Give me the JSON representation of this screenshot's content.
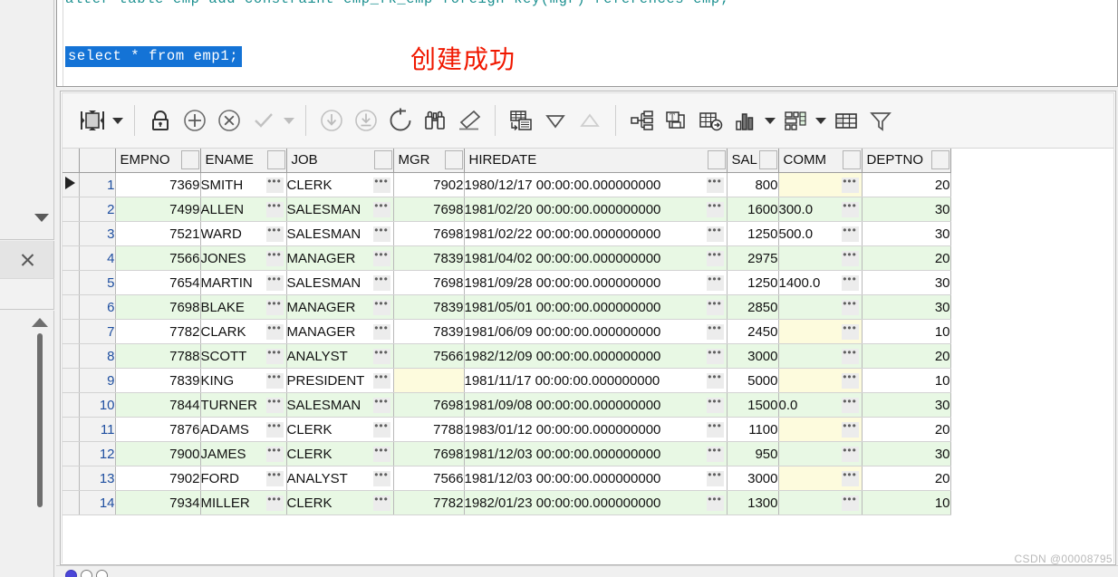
{
  "editor": {
    "line1_prefix": "alter table ",
    "line1_full": "alter table emp add constraint emp_fk_emp foreign key(mgr) references emp;",
    "line2_selected": "select * from emp1;",
    "annotation": "创建成功"
  },
  "toolbar": {
    "items": [
      {
        "name": "single-record-view-icon",
        "label": "Single Record View",
        "dim": false,
        "caret": true
      },
      {
        "name": "lock-icon",
        "label": "Lock Record",
        "dim": false,
        "caret": false
      },
      {
        "name": "plus-circle-icon",
        "label": "Insert Record",
        "dim": false,
        "caret": false
      },
      {
        "name": "cancel-circle-icon",
        "label": "Delete Record",
        "dim": false,
        "caret": false
      },
      {
        "name": "check-icon",
        "label": "Post Edit",
        "dim": true,
        "caret": true
      },
      {
        "name": "download-circle-icon",
        "label": "Fetch Next",
        "dim": true,
        "caret": false
      },
      {
        "name": "download-all-circle-icon",
        "label": "Fetch All",
        "dim": true,
        "caret": false
      },
      {
        "name": "refresh-circle-icon",
        "label": "Refresh",
        "dim": false,
        "caret": false
      },
      {
        "name": "binoculars-icon",
        "label": "Find",
        "dim": false,
        "caret": false
      },
      {
        "name": "eraser-icon",
        "label": "Clear Filter",
        "dim": false,
        "caret": false
      },
      {
        "name": "grid-to-text-icon",
        "label": "Copy as Text",
        "dim": false,
        "caret": false
      },
      {
        "name": "sort-descending-icon",
        "label": "Sort Descending",
        "dim": false,
        "caret": false
      },
      {
        "name": "sort-ascending-icon",
        "label": "Sort Ascending",
        "dim": true,
        "caret": false
      },
      {
        "name": "tree-view-icon",
        "label": "Tree View",
        "dim": false,
        "caret": false
      },
      {
        "name": "export-text-icon",
        "label": "Export Text",
        "dim": false,
        "caret": false
      },
      {
        "name": "grid-export-icon",
        "label": "Export Grid",
        "dim": false,
        "caret": false
      },
      {
        "name": "bar-chart-icon",
        "label": "Chart",
        "dim": false,
        "caret": true
      },
      {
        "name": "pivot-grid-icon",
        "label": "Pivot",
        "dim": false,
        "caret": true
      },
      {
        "name": "table-grid-icon",
        "label": "Grid View",
        "dim": false,
        "caret": false
      },
      {
        "name": "funnel-filter-icon",
        "label": "Filter",
        "dim": false,
        "caret": false
      }
    ]
  },
  "grid": {
    "columns": [
      "EMPNO",
      "ENAME",
      "JOB",
      "MGR",
      "HIREDATE",
      "SAL",
      "COMM",
      "DEPTNO"
    ],
    "selected_row": 1,
    "rows": [
      {
        "n": "1",
        "EMPNO": "7369",
        "ENAME": "SMITH",
        "JOB": "CLERK",
        "MGR": "7902",
        "HIREDATE": "1980/12/17 00:00:00.000000000",
        "SAL": "800",
        "COMM": "",
        "DEPTNO": "20"
      },
      {
        "n": "2",
        "EMPNO": "7499",
        "ENAME": "ALLEN",
        "JOB": "SALESMAN",
        "MGR": "7698",
        "HIREDATE": "1981/02/20 00:00:00.000000000",
        "SAL": "1600",
        "COMM": "300.0",
        "DEPTNO": "30"
      },
      {
        "n": "3",
        "EMPNO": "7521",
        "ENAME": "WARD",
        "JOB": "SALESMAN",
        "MGR": "7698",
        "HIREDATE": "1981/02/22 00:00:00.000000000",
        "SAL": "1250",
        "COMM": "500.0",
        "DEPTNO": "30"
      },
      {
        "n": "4",
        "EMPNO": "7566",
        "ENAME": "JONES",
        "JOB": "MANAGER",
        "MGR": "7839",
        "HIREDATE": "1981/04/02 00:00:00.000000000",
        "SAL": "2975",
        "COMM": "",
        "DEPTNO": "20"
      },
      {
        "n": "5",
        "EMPNO": "7654",
        "ENAME": "MARTIN",
        "JOB": "SALESMAN",
        "MGR": "7698",
        "HIREDATE": "1981/09/28 00:00:00.000000000",
        "SAL": "1250",
        "COMM": "1400.0",
        "DEPTNO": "30"
      },
      {
        "n": "6",
        "EMPNO": "7698",
        "ENAME": "BLAKE",
        "JOB": "MANAGER",
        "MGR": "7839",
        "HIREDATE": "1981/05/01 00:00:00.000000000",
        "SAL": "2850",
        "COMM": "",
        "DEPTNO": "30"
      },
      {
        "n": "7",
        "EMPNO": "7782",
        "ENAME": "CLARK",
        "JOB": "MANAGER",
        "MGR": "7839",
        "HIREDATE": "1981/06/09 00:00:00.000000000",
        "SAL": "2450",
        "COMM": "",
        "DEPTNO": "10"
      },
      {
        "n": "8",
        "EMPNO": "7788",
        "ENAME": "SCOTT",
        "JOB": "ANALYST",
        "MGR": "7566",
        "HIREDATE": "1982/12/09 00:00:00.000000000",
        "SAL": "3000",
        "COMM": "",
        "DEPTNO": "20"
      },
      {
        "n": "9",
        "EMPNO": "7839",
        "ENAME": "KING",
        "JOB": "PRESIDENT",
        "MGR": "",
        "HIREDATE": "1981/11/17 00:00:00.000000000",
        "SAL": "5000",
        "COMM": "",
        "DEPTNO": "10"
      },
      {
        "n": "10",
        "EMPNO": "7844",
        "ENAME": "TURNER",
        "JOB": "SALESMAN",
        "MGR": "7698",
        "HIREDATE": "1981/09/08 00:00:00.000000000",
        "SAL": "1500",
        "COMM": "0.0",
        "DEPTNO": "30"
      },
      {
        "n": "11",
        "EMPNO": "7876",
        "ENAME": "ADAMS",
        "JOB": "CLERK",
        "MGR": "7788",
        "HIREDATE": "1983/01/12 00:00:00.000000000",
        "SAL": "1100",
        "COMM": "",
        "DEPTNO": "20"
      },
      {
        "n": "12",
        "EMPNO": "7900",
        "ENAME": "JAMES",
        "JOB": "CLERK",
        "MGR": "7698",
        "HIREDATE": "1981/12/03 00:00:00.000000000",
        "SAL": "950",
        "COMM": "",
        "DEPTNO": "30"
      },
      {
        "n": "13",
        "EMPNO": "7902",
        "ENAME": "FORD",
        "JOB": "ANALYST",
        "MGR": "7566",
        "HIREDATE": "1981/12/03 00:00:00.000000000",
        "SAL": "3000",
        "COMM": "",
        "DEPTNO": "20"
      },
      {
        "n": "14",
        "EMPNO": "7934",
        "ENAME": "MILLER",
        "JOB": "CLERK",
        "MGR": "7782",
        "HIREDATE": "1982/01/23 00:00:00.000000000",
        "SAL": "1300",
        "COMM": "",
        "DEPTNO": "10"
      }
    ],
    "cell_more_glyph": "•••"
  },
  "watermark": "CSDN @00008795",
  "colors": {
    "selection_blue": "#1473d6",
    "annotation_red": "#f01800",
    "row_even_green": "#e8f8e4",
    "null_cell_yellow": "#fdfbdd",
    "keyword_teal": "#177f9e"
  }
}
